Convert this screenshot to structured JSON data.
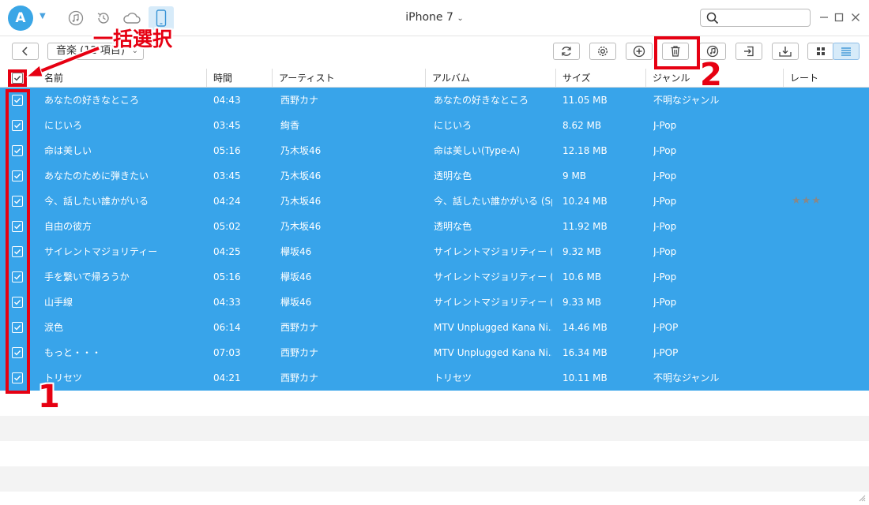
{
  "titlebar": {
    "logo_letter": "A",
    "device_name": "iPhone 7",
    "search_placeholder": ""
  },
  "toolbar": {
    "category_label": "音楽 (12 項目)"
  },
  "table": {
    "headers": {
      "name": "名前",
      "time": "時間",
      "artist": "アーティスト",
      "album": "アルバム",
      "size": "サイズ",
      "genre": "ジャンル",
      "rate": "レート"
    },
    "rows": [
      {
        "name": "あなたの好きなところ",
        "time": "04:43",
        "artist": "西野カナ",
        "album": "あなたの好きなところ",
        "size": "11.05 MB",
        "genre": "不明なジャンル",
        "rating": ""
      },
      {
        "name": "にじいろ",
        "time": "03:45",
        "artist": "絢香",
        "album": "にじいろ",
        "size": "8.62 MB",
        "genre": "J-Pop",
        "rating": ""
      },
      {
        "name": "命は美しい",
        "time": "05:16",
        "artist": "乃木坂46",
        "album": "命は美しい(Type-A)",
        "size": "12.18 MB",
        "genre": "J-Pop",
        "rating": ""
      },
      {
        "name": "あなたのために弾きたい",
        "time": "03:45",
        "artist": "乃木坂46",
        "album": "透明な色",
        "size": "9 MB",
        "genre": "J-Pop",
        "rating": ""
      },
      {
        "name": "今、話したい誰かがいる",
        "time": "04:24",
        "artist": "乃木坂46",
        "album": "今、話したい誰かがいる (Sp...",
        "size": "10.24 MB",
        "genre": "J-Pop",
        "rating": "★★★"
      },
      {
        "name": "自由の彼方",
        "time": "05:02",
        "artist": "乃木坂46",
        "album": "透明な色",
        "size": "11.92 MB",
        "genre": "J-Pop",
        "rating": ""
      },
      {
        "name": "サイレントマジョリティー",
        "time": "04:25",
        "artist": "欅坂46",
        "album": "サイレントマジョリティー (Spec...",
        "size": "9.32 MB",
        "genre": "J-Pop",
        "rating": ""
      },
      {
        "name": "手を繋いで帰ろうか",
        "time": "05:16",
        "artist": "欅坂46",
        "album": "サイレントマジョリティー (Spec...",
        "size": "10.6 MB",
        "genre": "J-Pop",
        "rating": ""
      },
      {
        "name": "山手線",
        "time": "04:33",
        "artist": "欅坂46",
        "album": "サイレントマジョリティー (Spec...",
        "size": "9.33 MB",
        "genre": "J-Pop",
        "rating": ""
      },
      {
        "name": "涙色",
        "time": "06:14",
        "artist": "西野カナ",
        "album": "MTV Unplugged Kana Ni...",
        "size": "14.46 MB",
        "genre": "J-POP",
        "rating": ""
      },
      {
        "name": "もっと・・・",
        "time": "07:03",
        "artist": "西野カナ",
        "album": "MTV Unplugged Kana Ni...",
        "size": "16.34 MB",
        "genre": "J-POP",
        "rating": ""
      },
      {
        "name": "トリセツ",
        "time": "04:21",
        "artist": "西野カナ",
        "album": "トリセツ",
        "size": "10.11 MB",
        "genre": "不明なジャンル",
        "rating": ""
      }
    ]
  },
  "annotations": {
    "select_all_label": "一括選択",
    "step1": "1",
    "step2": "2"
  },
  "colors": {
    "selection_blue": "#38a4ea",
    "annotation_red": "#e60012",
    "accent": "#3aa6e6"
  }
}
